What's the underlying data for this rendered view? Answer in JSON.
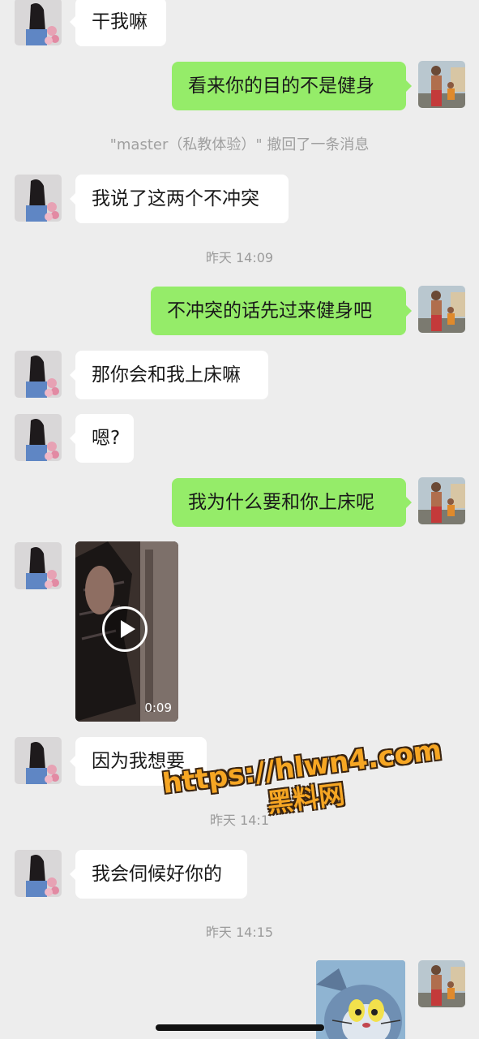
{
  "messages": [
    {
      "side": "in",
      "text": "干我嘛"
    },
    {
      "side": "out",
      "text": "看来你的目的不是健身"
    },
    {
      "type": "recall",
      "text": "\"master（私教体验）\" 撤回了一条消息"
    },
    {
      "side": "in",
      "text": "我说了这两个不冲突"
    },
    {
      "type": "time",
      "text": "昨天 14:09"
    },
    {
      "side": "out",
      "text": "不冲突的话先过来健身吧"
    },
    {
      "side": "in",
      "text": "那你会和我上床嘛"
    },
    {
      "side": "in",
      "text": "嗯?"
    },
    {
      "side": "out",
      "text": "我为什么要和你上床呢"
    },
    {
      "side": "in",
      "type": "video",
      "duration": "0:09"
    },
    {
      "side": "in",
      "text": "因为我想要"
    },
    {
      "type": "time",
      "text": "昨天 14:1"
    },
    {
      "side": "in",
      "text": "我会伺候好你的"
    },
    {
      "type": "time",
      "text": "昨天 14:15"
    },
    {
      "side": "out",
      "type": "sticker"
    }
  ],
  "watermark": {
    "url": "https://hlwn4.com",
    "brand": "黑料网",
    "color": "#f6a623"
  },
  "colors": {
    "background": "#ededed",
    "incoming_bubble": "#ffffff",
    "outgoing_bubble": "#95ec69",
    "timestamp": "#9b9b9b"
  }
}
